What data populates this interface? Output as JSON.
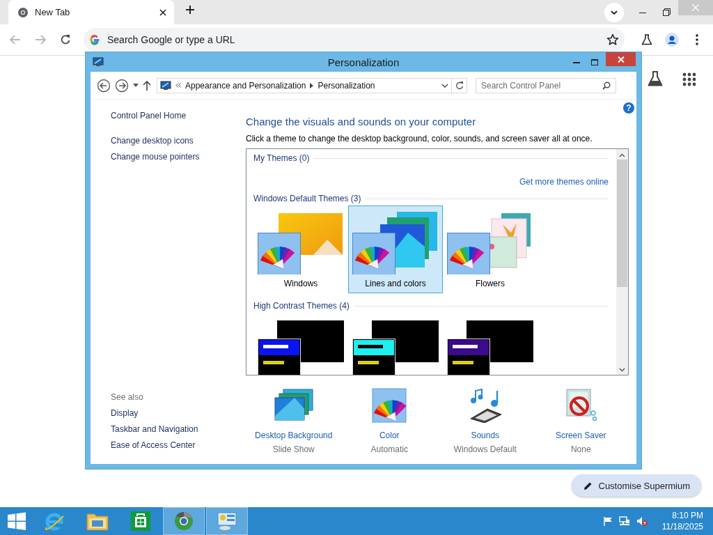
{
  "browser": {
    "tab": {
      "title": "New Tab"
    },
    "omnibox": {
      "placeholder": "Search Google or type a URL"
    }
  },
  "window": {
    "title": "Personalization",
    "breadcrumb": [
      {
        "label": "Appearance and Personalization"
      },
      {
        "label": "Personalization"
      }
    ],
    "search": {
      "placeholder": "Search Control Panel"
    },
    "help_button": "?"
  },
  "sidebar": {
    "items": [
      {
        "label": "Control Panel Home"
      },
      {
        "label": "Change desktop icons"
      },
      {
        "label": "Change mouse pointers"
      }
    ],
    "see_also": {
      "title": "See also",
      "items": [
        {
          "label": "Display"
        },
        {
          "label": "Taskbar and Navigation"
        },
        {
          "label": "Ease of Access Center"
        }
      ]
    }
  },
  "main": {
    "heading": "Change the visuals and sounds on your computer",
    "description": "Click a theme to change the desktop background, color, sounds, and screen saver all at once.",
    "gallery": {
      "groups": [
        {
          "title": "My Themes (0)",
          "link": "Get more themes online"
        },
        {
          "title": "Windows Default Themes (3)",
          "themes": [
            {
              "label": "Windows",
              "kind": "windows",
              "selected": false
            },
            {
              "label": "Lines and colors",
              "kind": "lines",
              "selected": true
            },
            {
              "label": "Flowers",
              "kind": "flowers",
              "selected": false
            }
          ]
        },
        {
          "title": "High Contrast Themes (4)",
          "themes": [
            {
              "kind": "contrast",
              "color": "#0a14f0",
              "selected": false
            },
            {
              "kind": "contrast",
              "color": "#1ef0f0",
              "selected": false
            },
            {
              "kind": "contrast",
              "color": "#3c0a8c",
              "selected": false
            }
          ]
        }
      ]
    },
    "settings": [
      {
        "kind": "background",
        "label": "Desktop Background",
        "value": "Slide Show"
      },
      {
        "kind": "color",
        "label": "Color",
        "value": "Automatic"
      },
      {
        "kind": "sounds",
        "label": "Sounds",
        "value": "Windows Default"
      },
      {
        "kind": "screensaver",
        "label": "Screen Saver",
        "value": "None"
      }
    ]
  },
  "customise_button": {
    "label": "Customise Supermium"
  },
  "taskbar": {
    "apps": [
      {
        "kind": "ie",
        "active": false
      },
      {
        "kind": "explorer",
        "active": false
      },
      {
        "kind": "store",
        "active": false
      },
      {
        "kind": "chrome",
        "active": true
      },
      {
        "kind": "control-panel",
        "active": true
      }
    ],
    "tray": {
      "time": "8:10 PM",
      "date": "11/18/2025"
    }
  }
}
